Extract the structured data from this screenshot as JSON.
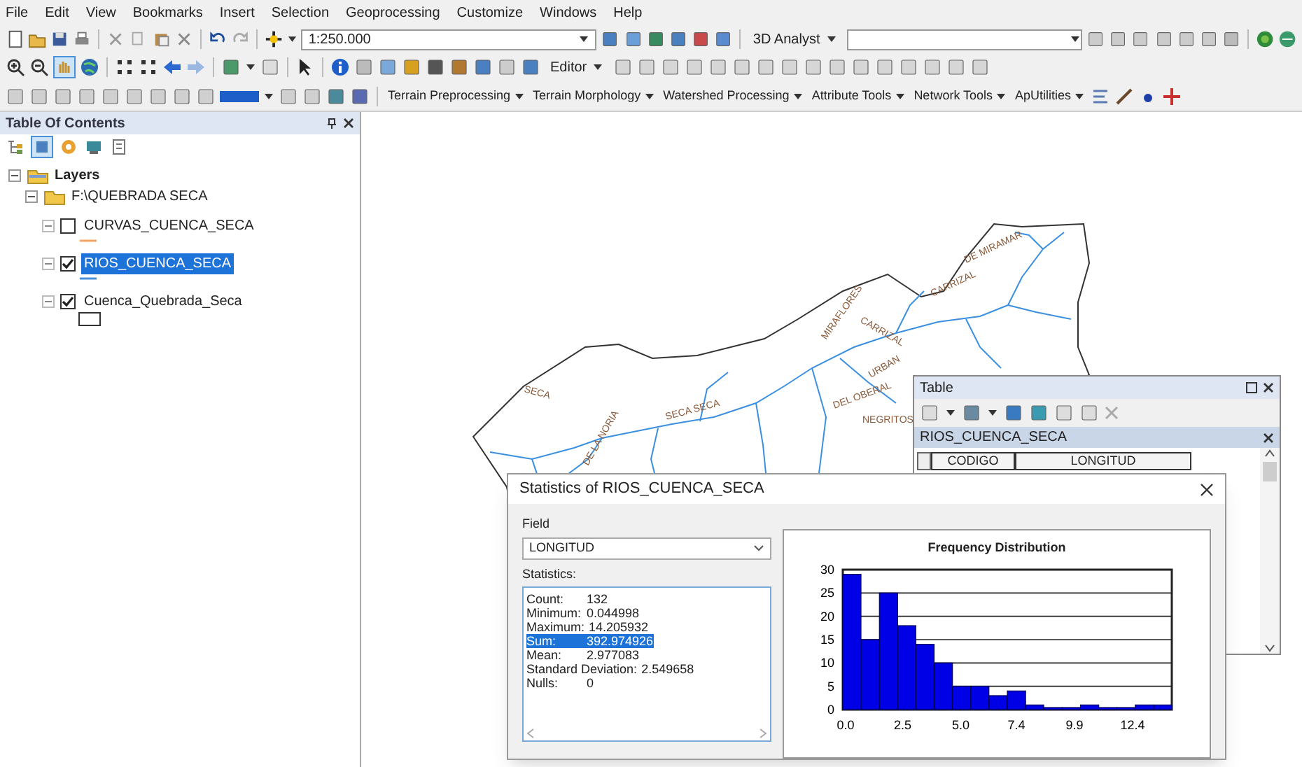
{
  "menu_bar": [
    "File",
    "Edit",
    "View",
    "Bookmarks",
    "Insert",
    "Selection",
    "Geoprocessing",
    "Customize",
    "Windows",
    "Help"
  ],
  "toolbar_1": {
    "scale_field": "1:250.000",
    "analyst_menu": "3D Analyst"
  },
  "toolbar_2": {
    "editor_menu": "Editor"
  },
  "toolbar_3": {
    "menus": [
      "Terrain Preprocessing",
      "Terrain Morphology",
      "Watershed Processing",
      "Attribute Tools",
      "Network Tools",
      "ApUtilities"
    ]
  },
  "toc": {
    "title": "Table Of Contents",
    "tree": [
      {
        "label": "Layers",
        "expanded": true,
        "children": [
          {
            "label": "F:\\QUEBRADA SECA",
            "expanded": true,
            "children": [
              {
                "label": "CURVAS_CUENCA_SECA",
                "checked": false,
                "selected": false,
                "kind": "line",
                "color": "#f4a460"
              },
              {
                "label": "RIOS_CUENCA_SECA",
                "checked": true,
                "selected": true,
                "kind": "line",
                "color": "#4a90d9"
              },
              {
                "label": "Cuenca_Quebrada_Seca",
                "checked": true,
                "selected": false,
                "kind": "polygon"
              }
            ]
          }
        ]
      }
    ]
  },
  "map": {
    "labels": [
      "DE MIRAMAR",
      "CARRIZAL",
      "CARRIZAL",
      "MIRAFLORES",
      "URBAN",
      "DEL OBERAL",
      "NEGRITOS",
      "SECA SECA",
      "SECA",
      "DE LA NORIA"
    ]
  },
  "table_window": {
    "title": "Table",
    "layer_tab": "RIOS_CUENCA_SECA",
    "columns": [
      "CODIGO",
      "LONGITUD"
    ]
  },
  "statistics_dialog": {
    "title": "Statistics of RIOS_CUENCA_SECA",
    "field_label": "Field",
    "field_value": "LONGITUD",
    "statistics_label": "Statistics:",
    "rows": [
      {
        "label": "Count:",
        "value": "132",
        "selected": false
      },
      {
        "label": "Minimum:",
        "value": "0.044998",
        "selected": false
      },
      {
        "label": "Maximum:",
        "value": "14.205932",
        "selected": false
      },
      {
        "label": "Sum:",
        "value": "392.974926",
        "selected": true
      },
      {
        "label": "Mean:",
        "value": "2.977083",
        "selected": false
      },
      {
        "label": "Standard Deviation:",
        "value": "2.549658",
        "selected": false
      },
      {
        "label": "Nulls:",
        "value": "0",
        "selected": false
      }
    ],
    "chart_data": {
      "type": "bar",
      "title": "Frequency Distribution",
      "x": [
        0.43,
        1.22,
        2.01,
        2.79,
        3.58,
        4.37,
        5.15,
        5.94,
        6.73,
        7.52,
        8.3,
        9.09,
        9.88,
        10.67,
        11.45,
        12.24,
        13.03,
        13.82
      ],
      "grid": true,
      "values": [
        29,
        15,
        25,
        18,
        14,
        10,
        5,
        5,
        3,
        4,
        1,
        0,
        0,
        1,
        0,
        0,
        1,
        1
      ],
      "xlim": [
        0.04,
        14.21
      ],
      "ylim": [
        0,
        30
      ],
      "xticks": [
        {
          "value": 0.04,
          "label": "0.0"
        },
        {
          "value": 2.5,
          "label": "2.5"
        },
        {
          "value": 5.0,
          "label": "5.0"
        },
        {
          "value": 7.4,
          "label": "7.4"
        },
        {
          "value": 9.9,
          "label": "9.9"
        },
        {
          "value": 12.4,
          "label": "12.4"
        }
      ],
      "yticks": [
        0,
        5,
        10,
        15,
        20,
        25,
        30
      ]
    }
  }
}
